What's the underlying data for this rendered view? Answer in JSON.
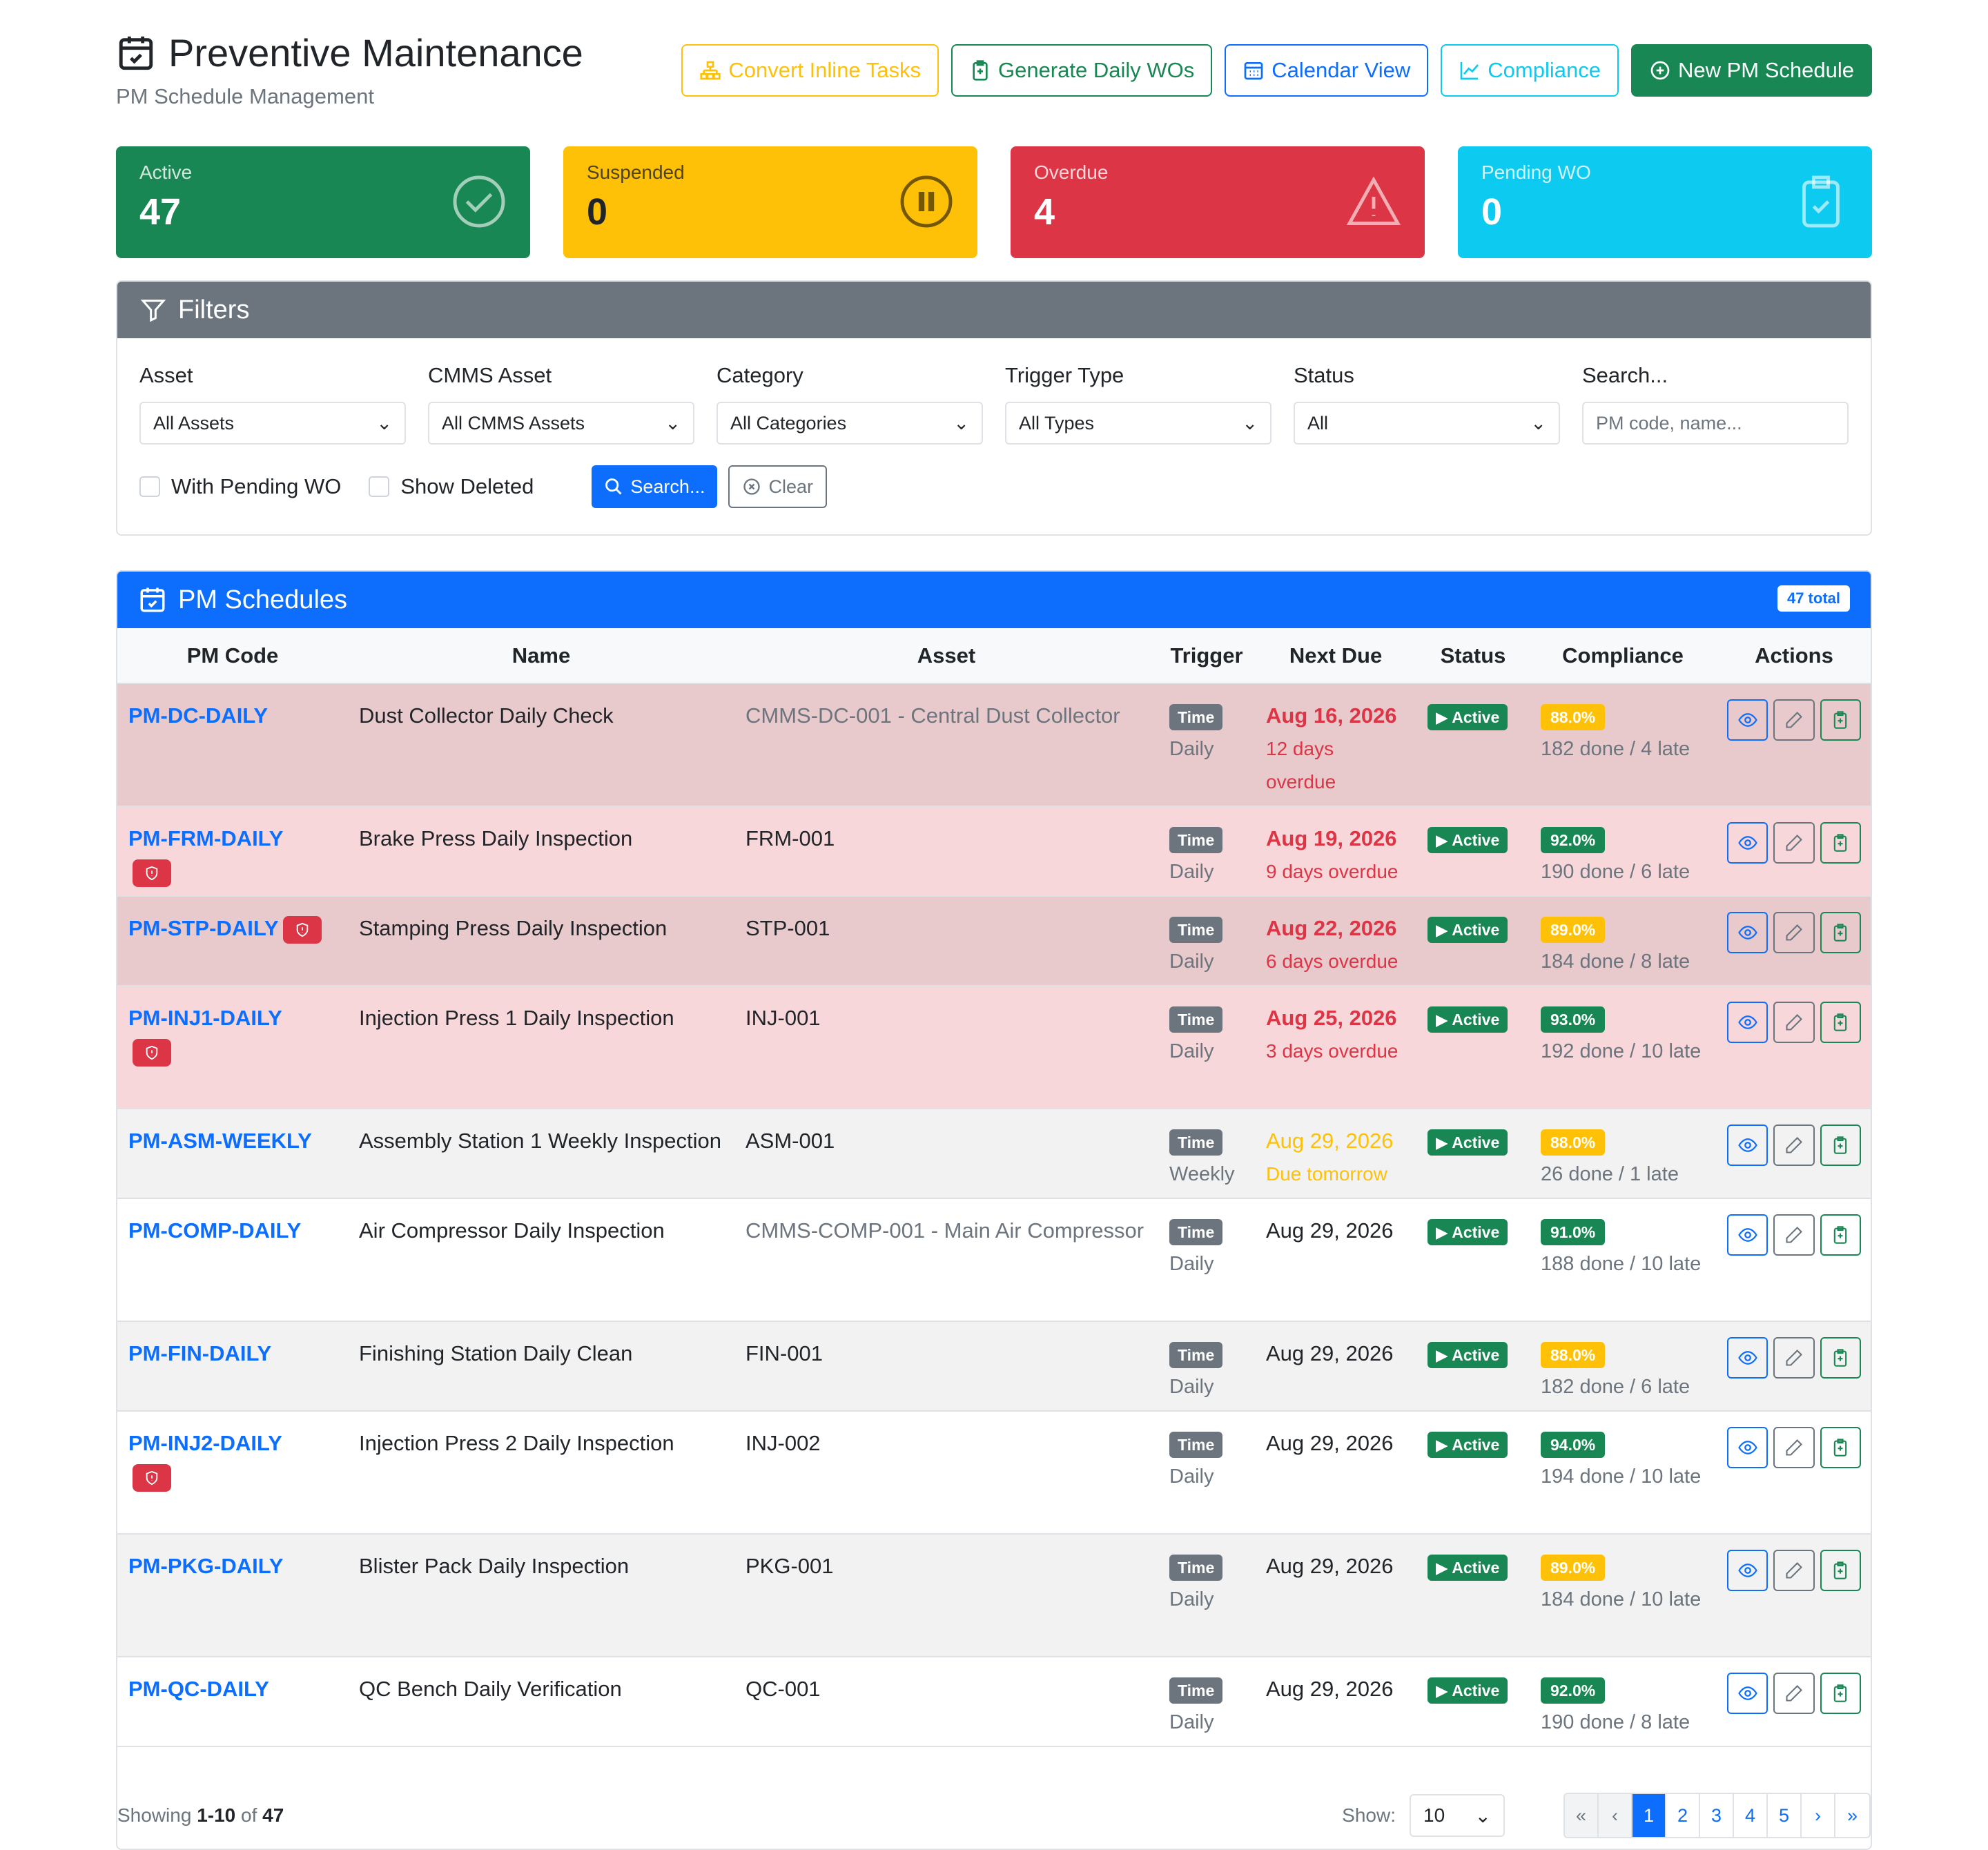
{
  "header": {
    "title": "Preventive Maintenance",
    "subtitle": "PM Schedule Management",
    "buttons": {
      "convert": "Convert Inline Tasks",
      "generate": "Generate Daily WOs",
      "calendar": "Calendar View",
      "compliance": "Compliance",
      "new": "New PM Schedule"
    }
  },
  "stats": {
    "active": {
      "label": "Active",
      "value": "47"
    },
    "suspended": {
      "label": "Suspended",
      "value": "0"
    },
    "overdue": {
      "label": "Overdue",
      "value": "4"
    },
    "pending": {
      "label": "Pending WO",
      "value": "0"
    }
  },
  "filters": {
    "title": "Filters",
    "asset": {
      "label": "Asset",
      "value": "All Assets"
    },
    "cmms": {
      "label": "CMMS Asset",
      "value": "All CMMS Assets"
    },
    "category": {
      "label": "Category",
      "value": "All Categories"
    },
    "trigger": {
      "label": "Trigger Type",
      "value": "All Types"
    },
    "status": {
      "label": "Status",
      "value": "All"
    },
    "search": {
      "label": "Search...",
      "placeholder": "PM code, name..."
    },
    "with_pending": "With Pending WO",
    "show_deleted": "Show Deleted",
    "search_btn": "Search...",
    "clear_btn": "Clear"
  },
  "table": {
    "title": "PM Schedules",
    "total": "47 total",
    "columns": [
      "PM Code",
      "Name",
      "Asset",
      "Trigger",
      "Next Due",
      "Status",
      "Compliance",
      "Actions"
    ],
    "rows": [
      {
        "code": "PM-DC-DAILY",
        "name": "Dust Collector Daily Check",
        "asset": "CMMS-DC-001 - Central Dust Collector",
        "trigger": "Time",
        "freq": "Daily",
        "due": "Aug 16, 2026",
        "due_note": "12 days overdue",
        "status": "Active",
        "compliance": "88.0%",
        "counts": "182 done / 4 late"
      },
      {
        "code": "PM-FRM-DAILY",
        "name": "Brake Press Daily Inspection",
        "asset": "FRM-001",
        "trigger": "Time",
        "freq": "Daily",
        "due": "Aug 19, 2026",
        "due_note": "9 days overdue",
        "status": "Active",
        "compliance": "92.0%",
        "counts": "190 done / 6 late"
      },
      {
        "code": "PM-STP-DAILY",
        "name": "Stamping Press Daily Inspection",
        "asset": "STP-001",
        "trigger": "Time",
        "freq": "Daily",
        "due": "Aug 22, 2026",
        "due_note": "6 days overdue",
        "status": "Active",
        "compliance": "89.0%",
        "counts": "184 done / 8 late"
      },
      {
        "code": "PM-INJ1-DAILY",
        "name": "Injection Press 1 Daily Inspection",
        "asset": "INJ-001",
        "trigger": "Time",
        "freq": "Daily",
        "due": "Aug 25, 2026",
        "due_note": "3 days overdue",
        "status": "Active",
        "compliance": "93.0%",
        "counts": "192 done / 10 late"
      },
      {
        "code": "PM-ASM-WEEKLY",
        "name": "Assembly Station 1 Weekly Inspection",
        "asset": "ASM-001",
        "trigger": "Time",
        "freq": "Weekly",
        "due": "Aug 29, 2026",
        "due_note": "Due tomorrow",
        "status": "Active",
        "compliance": "88.0%",
        "counts": "26 done / 1 late"
      },
      {
        "code": "PM-COMP-DAILY",
        "name": "Air Compressor Daily Inspection",
        "asset": "CMMS-COMP-001 - Main Air Compressor",
        "trigger": "Time",
        "freq": "Daily",
        "due": "Aug 29, 2026",
        "due_note": "",
        "status": "Active",
        "compliance": "91.0%",
        "counts": "188 done / 10 late"
      },
      {
        "code": "PM-FIN-DAILY",
        "name": "Finishing Station Daily Clean",
        "asset": "FIN-001",
        "trigger": "Time",
        "freq": "Daily",
        "due": "Aug 29, 2026",
        "due_note": "",
        "status": "Active",
        "compliance": "88.0%",
        "counts": "182 done / 6 late"
      },
      {
        "code": "PM-INJ2-DAILY",
        "name": "Injection Press 2 Daily Inspection",
        "asset": "INJ-002",
        "trigger": "Time",
        "freq": "Daily",
        "due": "Aug 29, 2026",
        "due_note": "",
        "status": "Active",
        "compliance": "94.0%",
        "counts": "194 done / 10 late"
      },
      {
        "code": "PM-PKG-DAILY",
        "name": "Blister Pack Daily Inspection",
        "asset": "PKG-001",
        "trigger": "Time",
        "freq": "Daily",
        "due": "Aug 29, 2026",
        "due_note": "",
        "status": "Active",
        "compliance": "89.0%",
        "counts": "184 done / 10 late"
      },
      {
        "code": "PM-QC-DAILY",
        "name": "QC Bench Daily Verification",
        "asset": "QC-001",
        "trigger": "Time",
        "freq": "Daily",
        "due": "Aug 29, 2026",
        "due_note": "",
        "status": "Active",
        "compliance": "92.0%",
        "counts": "190 done / 8 late"
      }
    ]
  },
  "footer": {
    "showing_prefix": "Showing ",
    "showing_range": "1-10",
    "showing_of": " of ",
    "showing_total": "47",
    "show_label": "Show:",
    "page_size": "10",
    "pages": [
      "1",
      "2",
      "3",
      "4",
      "5"
    ]
  },
  "colors": {
    "primary": "#0d6efd",
    "success": "#198754",
    "warning": "#ffc107",
    "danger": "#dc3545",
    "info": "#0dcaf0",
    "secondary": "#6c757d"
  }
}
